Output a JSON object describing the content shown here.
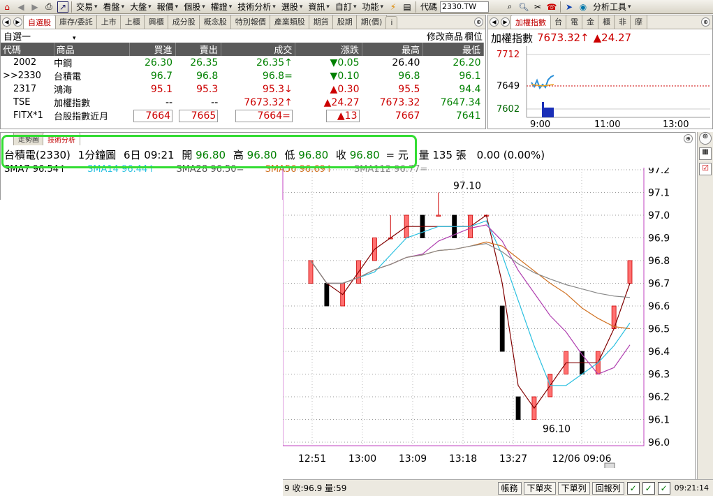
{
  "toolbar": {
    "items": [
      "交易",
      "看盤",
      "大盤",
      "報價",
      "個股",
      "權證",
      "技術分析",
      "選股",
      "資訊",
      "自訂",
      "功能"
    ],
    "code_label": "代碼",
    "code_value": "2330.TW",
    "analysis_tools": "分析工具"
  },
  "watchlist": {
    "tabs": [
      "自選股",
      "庫存/委託",
      "上市",
      "上櫃",
      "興櫃",
      "成分股",
      "概念股",
      "特別報價",
      "產業類股",
      "期貨",
      "股期",
      "期(價)",
      "i"
    ],
    "list_name": "自選一",
    "modify_label": "修改商品",
    "column_label": "欄位",
    "headers": [
      "代碼",
      "商品",
      "買進",
      "賣出",
      "成交",
      "漲跌",
      "最高",
      "最低"
    ],
    "rows": [
      {
        "code": "2002",
        "name": "中鋼",
        "bid": "26.30",
        "ask": "26.35",
        "last": "26.35↑",
        "chg": "▼0.05",
        "high": "26.40",
        "low": "26.20"
      },
      {
        "code": ">>2330",
        "name": "台積電",
        "bid": "96.7",
        "ask": "96.8",
        "last": "96.8=",
        "chg": "▼0.10",
        "high": "96.8",
        "low": "96.1"
      },
      {
        "code": "2317",
        "name": "鴻海",
        "bid": "95.1",
        "ask": "95.3",
        "last": "95.3↓",
        "chg": "▲0.30",
        "high": "95.5",
        "low": "94.4"
      },
      {
        "code": "TSE",
        "name": "加權指數",
        "bid": "--",
        "ask": "--",
        "last": "7673.32↑",
        "chg": "▲24.27",
        "high": "7673.32",
        "low": "7647.34"
      },
      {
        "code": "FITX*1",
        "name": "台股指數近月",
        "bid": "7664",
        "ask": "7665",
        "last": "7664=",
        "chg": "▲13",
        "high": "7667",
        "low": "7641"
      }
    ]
  },
  "index_panel": {
    "tabs": [
      "加權指數",
      "台",
      "電",
      "金",
      "櫃",
      "非",
      "摩"
    ],
    "name": "加權指數",
    "value": "7673.32↑",
    "change": "▲24.27",
    "y_labels": [
      "7712",
      "7649",
      "7602"
    ],
    "x_labels": [
      "9:00",
      "11:00",
      "13:00"
    ]
  },
  "chart": {
    "tabs": [
      "走勢圖",
      "技術分析"
    ],
    "stock": "台積電(2330)",
    "period": "1分鐘圖",
    "date_time": "6日 09:21",
    "open_label": "開",
    "open": "96.80",
    "high_label": "高",
    "high": "96.80",
    "low_label": "低",
    "low": "96.80",
    "close_label": "收",
    "close": "96.80",
    "unit": "= 元",
    "volume_label": "量",
    "volume": "135 張",
    "change": "0.00 (0.00%)",
    "ma_labels": [
      "SMA7 96.54↑",
      "SMA14 96.44↑",
      "SMA28 96.50=",
      "SMA56 96.69↑",
      "SMA112 96.77="
    ],
    "max_label": "97.10",
    "min_label": "96.10"
  },
  "chart_data": {
    "type": "candlestick",
    "y_ticks": [
      "97.2",
      "97.1",
      "97.0",
      "96.9",
      "96.8",
      "96.7",
      "96.6",
      "96.5",
      "96.4",
      "96.3",
      "96.2",
      "96.1",
      "96.0"
    ],
    "ylim": [
      96.0,
      97.2
    ],
    "x_ticks": [
      "12:51",
      "13:00",
      "13:09",
      "13:18",
      "13:27",
      "12/06 09:06"
    ],
    "candles": [
      {
        "o": 96.7,
        "c": 96.8,
        "h": 96.8,
        "l": 96.7
      },
      {
        "o": 96.7,
        "c": 96.6,
        "h": 96.7,
        "l": 96.6
      },
      {
        "o": 96.6,
        "c": 96.7,
        "h": 96.7,
        "l": 96.6
      },
      {
        "o": 96.7,
        "c": 96.8,
        "h": 96.8,
        "l": 96.7
      },
      {
        "o": 96.8,
        "c": 96.9,
        "h": 96.9,
        "l": 96.8
      },
      {
        "o": 96.9,
        "c": 96.9,
        "h": 97.0,
        "l": 96.9
      },
      {
        "o": 96.9,
        "c": 97.0,
        "h": 97.0,
        "l": 96.9
      },
      {
        "o": 97.0,
        "c": 96.9,
        "h": 97.0,
        "l": 96.9
      },
      {
        "o": 97.0,
        "c": 97.0,
        "h": 97.1,
        "l": 97.0
      },
      {
        "o": 97.0,
        "c": 96.9,
        "h": 97.0,
        "l": 96.9
      },
      {
        "o": 96.9,
        "c": 97.0,
        "h": 97.0,
        "l": 96.9
      },
      {
        "o": 97.0,
        "c": 97.0,
        "h": 97.0,
        "l": 97.0
      },
      {
        "o": 96.6,
        "c": 96.4,
        "h": 96.6,
        "l": 96.4
      },
      {
        "o": 96.2,
        "c": 96.1,
        "h": 96.2,
        "l": 96.1
      },
      {
        "o": 96.1,
        "c": 96.2,
        "h": 96.2,
        "l": 96.1
      },
      {
        "o": 96.2,
        "c": 96.3,
        "h": 96.3,
        "l": 96.2
      },
      {
        "o": 96.3,
        "c": 96.4,
        "h": 96.4,
        "l": 96.3
      },
      {
        "o": 96.4,
        "c": 96.3,
        "h": 96.4,
        "l": 96.3
      },
      {
        "o": 96.3,
        "c": 96.4,
        "h": 96.4,
        "l": 96.3
      },
      {
        "o": 96.5,
        "c": 96.6,
        "h": 96.6,
        "l": 96.5
      },
      {
        "o": 96.7,
        "c": 96.8,
        "h": 96.8,
        "l": 96.7
      }
    ]
  },
  "status": {
    "ticker": "9 收:96.9 量:59",
    "buttons": [
      "帳務",
      "下單夾",
      "下單列",
      "回報列"
    ],
    "time": "09:21:14"
  },
  "colors": {
    "up": "#cc0000",
    "down": "#000000",
    "green_box": "#33dd33"
  }
}
